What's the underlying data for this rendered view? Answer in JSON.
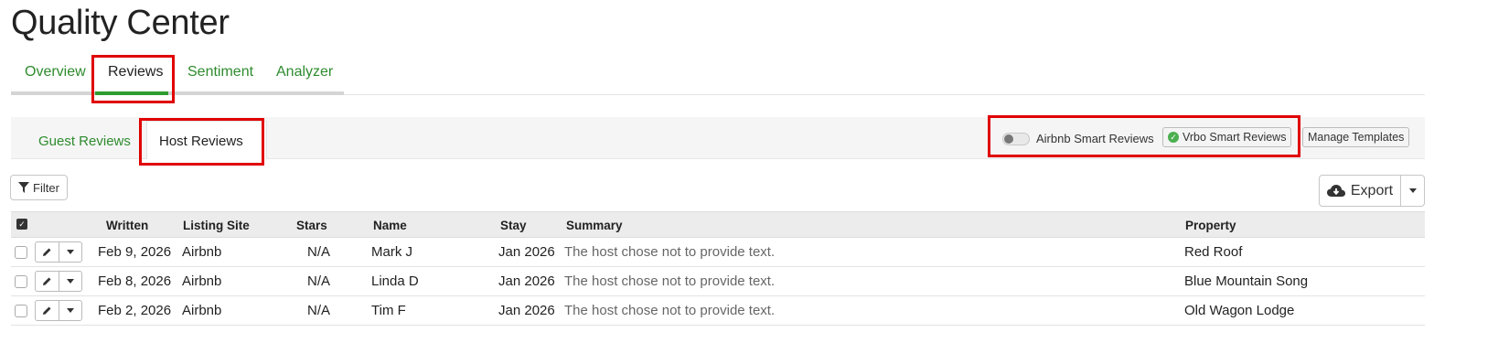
{
  "page": {
    "title": "Quality Center"
  },
  "main_tabs": [
    {
      "label": "Overview",
      "active": false
    },
    {
      "label": "Reviews",
      "active": true
    },
    {
      "label": "Sentiment",
      "active": false
    },
    {
      "label": "Analyzer",
      "active": false
    }
  ],
  "sub_tabs": [
    {
      "label": "Guest Reviews",
      "active": false
    },
    {
      "label": "Host Reviews",
      "active": true
    }
  ],
  "smart_reviews": {
    "airbnb_label": "Airbnb Smart Reviews",
    "airbnb_enabled": false,
    "vrbo_label": "Vrbo Smart Reviews",
    "vrbo_enabled": true,
    "manage_templates_label": "Manage Templates"
  },
  "toolbar": {
    "filter_label": "Filter",
    "export_label": "Export"
  },
  "table": {
    "columns": [
      "Written",
      "Listing Site",
      "Stars",
      "Name",
      "Stay",
      "Summary",
      "Property"
    ],
    "rows": [
      {
        "written": "Feb 9, 2026",
        "site": "Airbnb",
        "stars": "N/A",
        "name": "Mark J",
        "stay": "Jan 2026",
        "summary": "The host chose not to provide text.",
        "property": "Red Roof"
      },
      {
        "written": "Feb 8, 2026",
        "site": "Airbnb",
        "stars": "N/A",
        "name": "Linda D",
        "stay": "Jan 2026",
        "summary": "The host chose not to provide text.",
        "property": "Blue Mountain Song"
      },
      {
        "written": "Feb 2, 2026",
        "site": "Airbnb",
        "stars": "N/A",
        "name": "Tim F",
        "stay": "Jan 2026",
        "summary": "The host chose not to provide text.",
        "property": "Old Wagon Lodge"
      }
    ]
  },
  "colors": {
    "accent_green": "#2e8b2e",
    "highlight_red": "#e00000"
  }
}
